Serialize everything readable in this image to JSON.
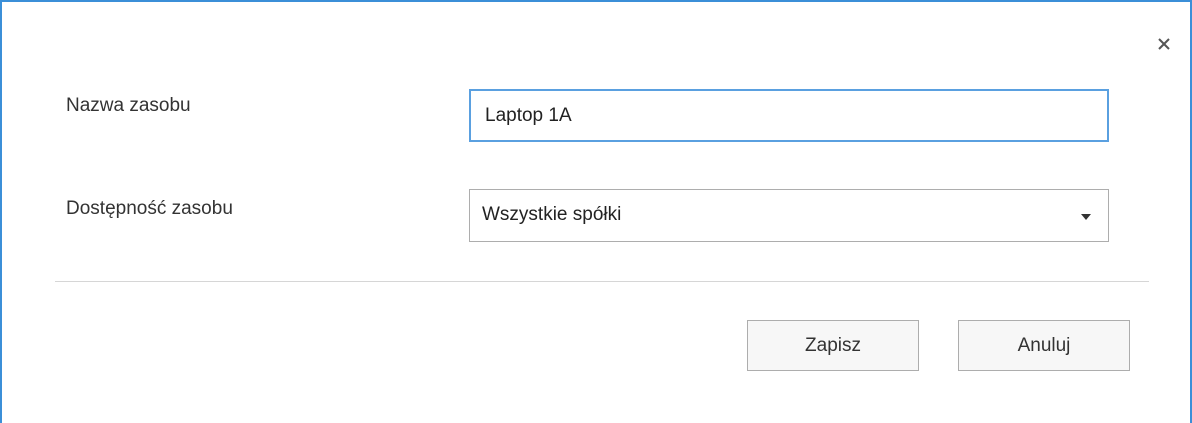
{
  "form": {
    "resource_name_label": "Nazwa zasobu",
    "resource_name_value": "Laptop 1A",
    "availability_label": "Dostępność zasobu",
    "availability_value": "Wszystkie spółki"
  },
  "actions": {
    "save_label": "Zapisz",
    "cancel_label": "Anuluj"
  },
  "icons": {
    "close": "close-icon",
    "dropdown": "caret-down-icon"
  },
  "colors": {
    "accent": "#3b8fd8",
    "focus_border": "#5aa0e0"
  }
}
